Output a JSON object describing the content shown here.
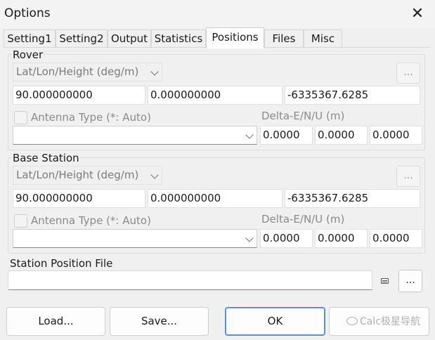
{
  "window": {
    "title": "Options",
    "close_glyph": "✕"
  },
  "tabs": [
    {
      "label": "Setting1"
    },
    {
      "label": "Setting2"
    },
    {
      "label": "Output"
    },
    {
      "label": "Statistics"
    },
    {
      "label": "Positions",
      "active": true
    },
    {
      "label": "Files"
    },
    {
      "label": "Misc"
    }
  ],
  "rover": {
    "group_label": "Rover",
    "position_type": "Lat/Lon/Height (deg/m)",
    "lat": "90.000000000",
    "lon": "0.000000000",
    "height": "-6335367.6285",
    "browse_label": "...",
    "antenna_label": "Antenna Type (*: Auto)",
    "antenna_value": "",
    "delta_label": "Delta-E/N/U (m)",
    "delta_e": "0.0000",
    "delta_n": "0.0000",
    "delta_u": "0.0000"
  },
  "base": {
    "group_label": "Base Station",
    "position_type": "Lat/Lon/Height (deg/m)",
    "lat": "90.000000000",
    "lon": "0.000000000",
    "height": "-6335367.6285",
    "browse_label": "...",
    "antenna_label": "Antenna Type (*: Auto)",
    "antenna_value": "",
    "delta_label": "Delta-E/N/U (m)",
    "delta_e": "0.0000",
    "delta_n": "0.0000",
    "delta_u": "0.0000"
  },
  "station_file": {
    "label": "Station Position File",
    "value": "",
    "browse_label": "..."
  },
  "footer": {
    "load_label": "Load...",
    "save_label": "Save...",
    "ok_label": "OK",
    "watermark_text": "Calc极星导航"
  },
  "icons": {
    "close": "close-icon",
    "view_file": "view-file-icon",
    "chevron": "chevron-down-icon"
  }
}
